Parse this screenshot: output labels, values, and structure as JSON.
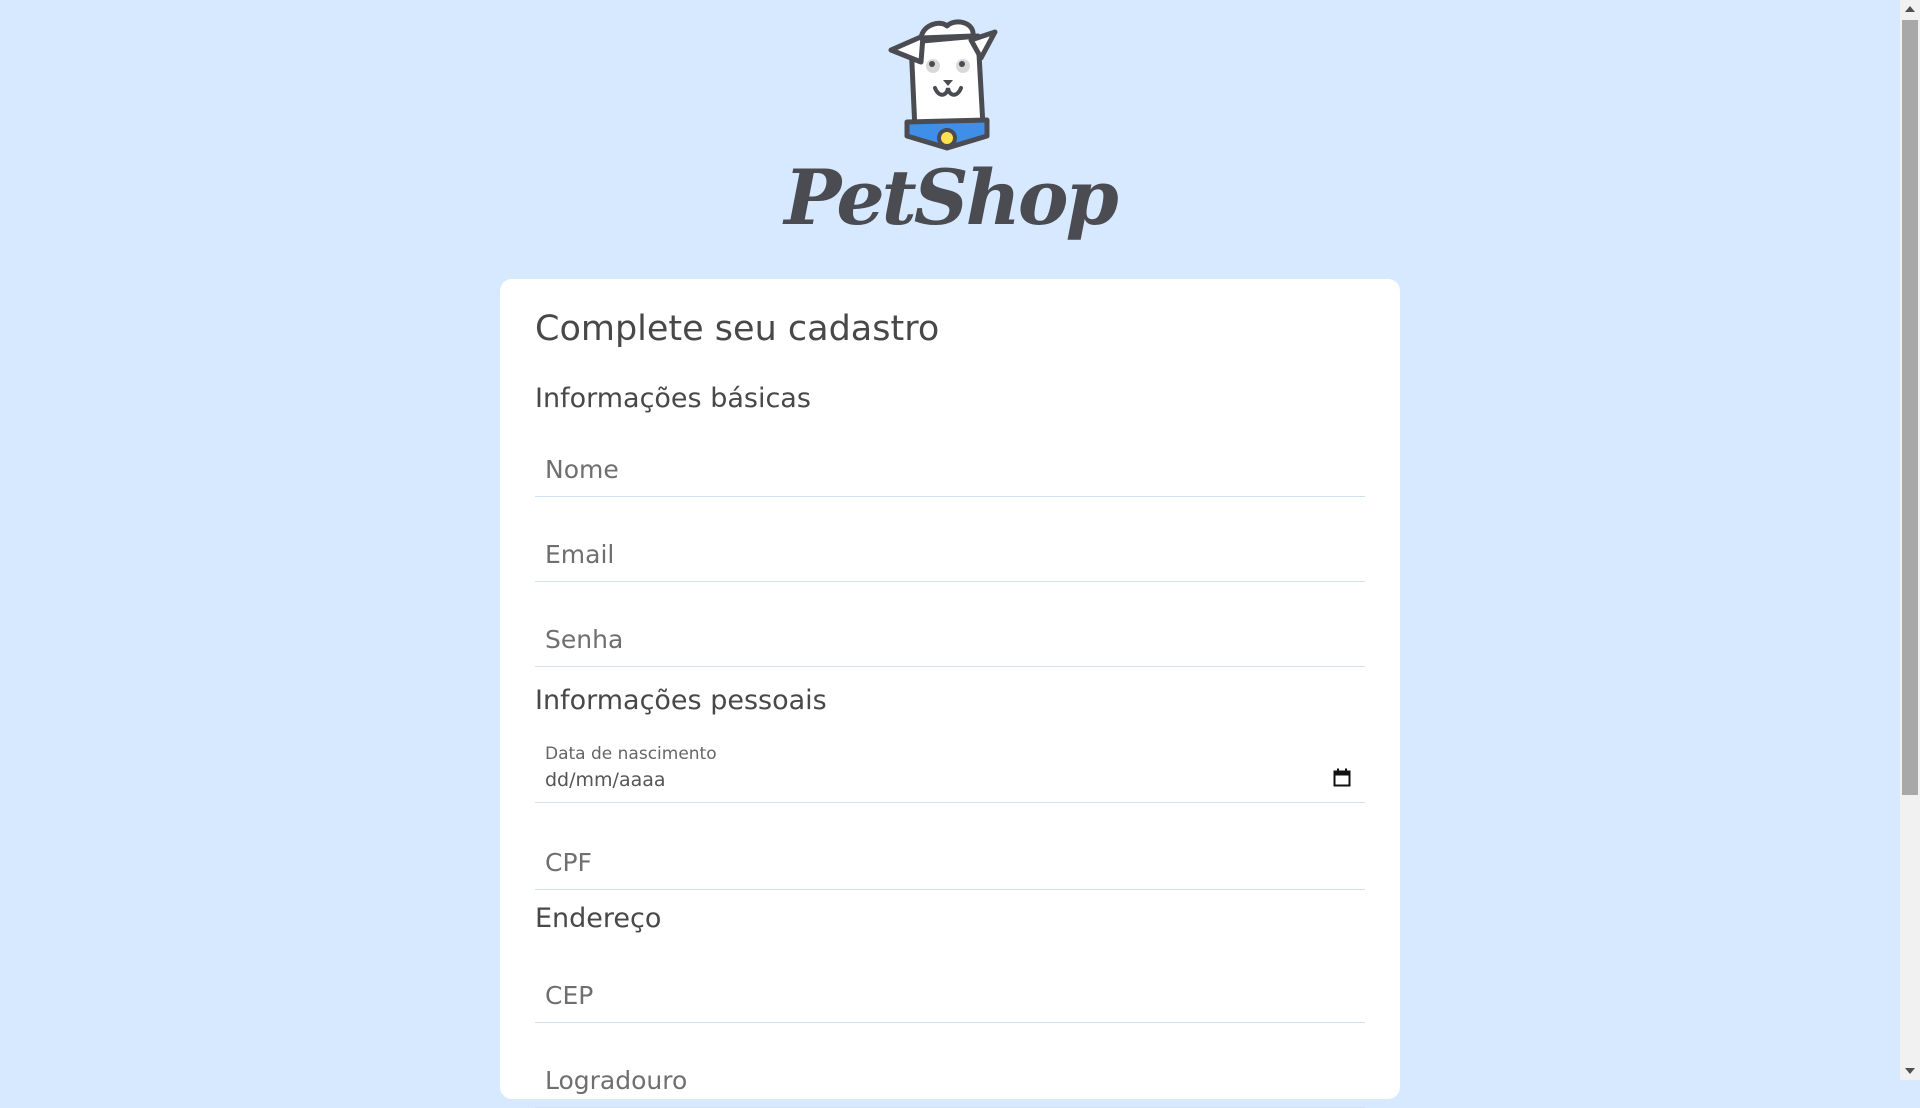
{
  "brand": {
    "name": "PetShop",
    "logo_icon": "dog-logo-icon"
  },
  "form": {
    "title": "Complete seu cadastro",
    "sections": {
      "basic": "Informações básicas",
      "personal": "Informações pessoais",
      "address": "Endereço"
    },
    "fields": {
      "nome_placeholder": "Nome",
      "email_placeholder": "Email",
      "senha_placeholder": "Senha",
      "birthdate_label": "Data de nascimento",
      "birthdate_value": "dd/mm/aaaa",
      "cpf_placeholder": "CPF",
      "cep_placeholder": "CEP",
      "logradouro_placeholder": "Logradouro"
    }
  },
  "colors": {
    "background": "#d6e9ff",
    "card": "#ffffff",
    "text": "#484848",
    "field_border": "#cfe0f0",
    "collar": "#3f8fe8"
  }
}
